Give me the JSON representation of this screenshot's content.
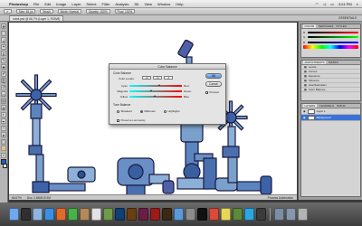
{
  "menubar": {
    "apple": "",
    "items": [
      "Photoshop",
      "File",
      "Edit",
      "Image",
      "Layer",
      "Select",
      "Filter",
      "Analysis",
      "3D",
      "View",
      "Window",
      "Help"
    ],
    "clock": "3:24 PM"
  },
  "optionsbar": {
    "items": [
      "Size: 45 px",
      "Brush",
      "Mode: Normal",
      "Opacity: 100%",
      "Flow: 100%"
    ]
  },
  "appbar": {
    "doc_tab": "robot.psd @ 66.7% (Layer 1, RGB/8)",
    "workspace": "ESSENTIALS"
  },
  "tools": {
    "icons": [
      "move-tool-icon",
      "marquee-tool-icon",
      "lasso-tool-icon",
      "magic-wand-icon",
      "crop-tool-icon",
      "eyedropper-icon",
      "healing-brush-icon",
      "brush-tool-icon",
      "clone-stamp-icon",
      "history-brush-icon",
      "eraser-icon",
      "gradient-tool-icon",
      "blur-tool-icon",
      "dodge-tool-icon",
      "pen-tool-icon",
      "type-tool-icon",
      "path-selection-icon",
      "shape-tool-icon",
      "hand-tool-icon",
      "zoom-tool-icon"
    ],
    "glyphs": [
      "✥",
      "⬚",
      "ʆ",
      "✦",
      "⌗",
      "✎",
      "✚",
      "✐",
      "⎘",
      "↺",
      "▭",
      "▤",
      "◍",
      "◐",
      "✒",
      "T",
      "➤",
      "▢",
      "✋",
      "⌕"
    ],
    "fg_color": "#1e5fb5",
    "bg_color": "#ffffff"
  },
  "statusbar": {
    "zoom": "66.67%",
    "doc": "Doc: 2.65M/15.9M",
    "right": "Process Automation"
  },
  "panels": {
    "color_tabs": [
      "COLOR",
      "SWATCHES",
      "STYLES"
    ],
    "adj_tabs": [
      "ADJUSTMENTS",
      "MASKS"
    ],
    "adj_items": [
      "Levels",
      "Curves",
      "Exposure",
      "Vibrance",
      "Hue/Saturation",
      "Color Balance"
    ],
    "layers_tabs": [
      "LAYERS",
      "CHANNELS",
      "PATHS"
    ],
    "layers": [
      {
        "name": "Layer 1",
        "selected": false
      },
      {
        "name": "Background",
        "selected": true
      }
    ]
  },
  "dialog": {
    "title": "Color Balance",
    "section_balance": "Color Balance",
    "levels_label": "Color Levels:",
    "levels": [
      "+6",
      "-11",
      "-4"
    ],
    "rows": [
      {
        "left": "Cyan",
        "right": "Red",
        "pos": 0.55
      },
      {
        "left": "Magenta",
        "right": "Green",
        "pos": 0.4
      },
      {
        "left": "Yellow",
        "right": "Blue",
        "pos": 0.46
      }
    ],
    "section_tone": "Tone Balance",
    "tones": [
      {
        "label": "Shadows",
        "on": false
      },
      {
        "label": "Midtones",
        "on": true
      },
      {
        "label": "Highlights",
        "on": false
      }
    ],
    "preserve": "Preserve Luminosity",
    "ok": "OK",
    "cancel": "Cancel",
    "preview": "Preview"
  },
  "dock": {
    "apps": [
      {
        "name": "finder-icon",
        "color": "#6fa8ec"
      },
      {
        "name": "dashboard-icon",
        "color": "#2f2f2f"
      },
      {
        "name": "mail-icon",
        "color": "#8fb5e0"
      },
      {
        "name": "safari-icon",
        "color": "#3c8fe0"
      },
      {
        "name": "firefox-icon",
        "color": "#e06a2c"
      },
      {
        "name": "ichat-icon",
        "color": "#4ab04a"
      },
      {
        "name": "address-book-icon",
        "color": "#b4895a"
      },
      {
        "name": "ical-icon",
        "color": "#e3e3e3"
      },
      {
        "name": "iphoto-icon",
        "color": "#6f9b4a"
      },
      {
        "name": "photoshop-icon",
        "color": "#0f3f73"
      },
      {
        "name": "illustrator-icon",
        "color": "#6b3e12"
      },
      {
        "name": "indesign-icon",
        "color": "#6b1e45"
      },
      {
        "name": "flash-icon",
        "color": "#9b1b1b"
      },
      {
        "name": "bridge-icon",
        "color": "#3a2a14"
      },
      {
        "name": "itunes-icon",
        "color": "#5a9ad8"
      },
      {
        "name": "preferences-icon",
        "color": "#8c8c8c"
      },
      {
        "name": "terminal-icon",
        "color": "#111111"
      },
      {
        "name": "chrome-icon",
        "color": "#d94a3a"
      },
      {
        "name": "stickies-icon",
        "color": "#e6d75a"
      },
      {
        "name": "minecraft-icon",
        "color": "#5a8a3a"
      },
      {
        "name": "skype-icon",
        "color": "#2aa7e0"
      },
      {
        "name": "activity-icon",
        "color": "#3b3b3b"
      },
      {
        "name": "downloads-icon",
        "color": "#7d8ea3"
      },
      {
        "name": "documents-icon",
        "color": "#8797ab"
      },
      {
        "name": "trash-icon",
        "color": "#b3b3b3"
      }
    ]
  }
}
